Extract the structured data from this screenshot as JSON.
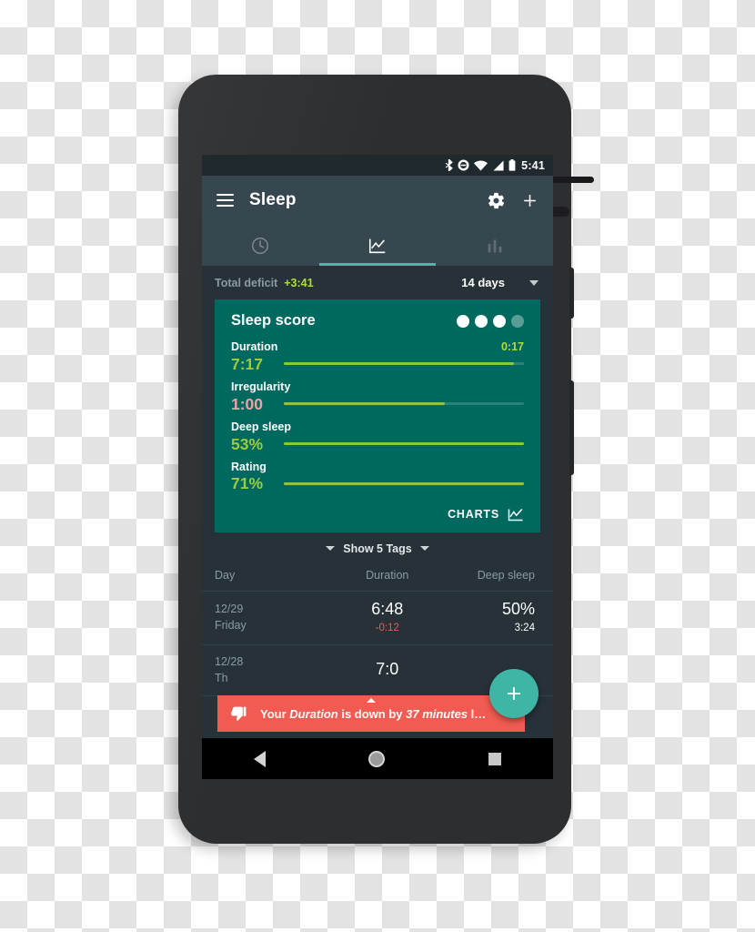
{
  "statusbar": {
    "icons": [
      "bluetooth-icon",
      "do-not-disturb-icon",
      "wifi-icon",
      "cellular-signal-icon",
      "battery-icon"
    ],
    "time": "5:41"
  },
  "appbar": {
    "menu_icon": "hamburger-menu-icon",
    "title": "Sleep",
    "settings_icon": "gear-icon",
    "add_icon": "plus-icon"
  },
  "tabs": [
    {
      "name": "tab-history",
      "icon": "clock-icon",
      "active": false
    },
    {
      "name": "tab-trends",
      "icon": "line-chart-icon",
      "active": true
    },
    {
      "name": "tab-stats",
      "icon": "bar-chart-icon",
      "active": false
    }
  ],
  "summary": {
    "deficit_label": "Total deficit",
    "deficit_value": "+3:41",
    "deficit_color": "#aede3c",
    "range_value": "14 days",
    "range_caret_icon": "chevron-down-icon"
  },
  "score_card": {
    "background": "#00695f",
    "title": "Sleep score",
    "dots_total": 4,
    "dots_filled": 3,
    "metrics": [
      {
        "name": "Duration",
        "value": "7:17",
        "extra": "0:17",
        "fill_pct": 96,
        "value_color": "#9ccc3c"
      },
      {
        "name": "Irregularity",
        "value": "1:00",
        "extra": "",
        "fill_pct": 67,
        "value_color": "#e7a6a6"
      },
      {
        "name": "Deep sleep",
        "value": "53%",
        "extra": "",
        "fill_pct": 100,
        "value_color": "#9ccc3c"
      },
      {
        "name": "Rating",
        "value": "71%",
        "extra": "",
        "fill_pct": 100,
        "value_color": "#9ccc3c"
      }
    ],
    "charts_label": "CHARTS",
    "charts_icon": "line-chart-icon"
  },
  "tags": {
    "label": "Show 5 Tags",
    "left_caret_icon": "triangle-down-icon",
    "right_caret_icon": "triangle-down-icon"
  },
  "table": {
    "headers": {
      "day": "Day",
      "duration": "Duration",
      "deep": "Deep sleep"
    },
    "rows": [
      {
        "date": "12/29",
        "weekday": "Friday",
        "duration": "6:48",
        "duration_delta": "-0:12",
        "deep_pct": "50%",
        "deep_time": "3:24"
      },
      {
        "date": "12/28",
        "weekday": "Th",
        "duration": "7:0",
        "duration_delta": "",
        "deep_pct": "",
        "deep_time": ""
      }
    ]
  },
  "snackbar": {
    "icon": "thumbs-down-icon",
    "background": "#f15b51",
    "text_prefix": "Your ",
    "text_em1": "Duration",
    "text_mid": " is down by ",
    "text_em2": "37 minutes",
    "text_suffix": " l…"
  },
  "fab": {
    "icon": "plus-icon",
    "color": "#3fb5a7"
  },
  "navbar": {
    "back": "back-triangle-icon",
    "home": "home-circle-icon",
    "recents": "recents-square-icon"
  }
}
